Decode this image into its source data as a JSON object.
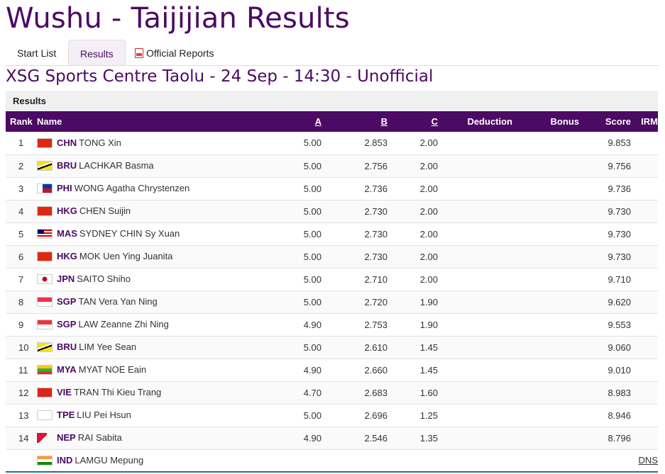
{
  "page": {
    "title": "Wushu - Taijijian Results"
  },
  "tabs": [
    {
      "label": "Start List"
    },
    {
      "label": "Results"
    },
    {
      "label": "Official Reports"
    }
  ],
  "venue_line": "XSG Sports Centre Taolu - 24 Sep - 14:30 - Unofficial",
  "results": {
    "panel_title": "Results",
    "headers": {
      "rank": "Rank",
      "name": "Name",
      "a": "A",
      "b": "B",
      "c": "C",
      "deduction": "Deduction",
      "bonus": "Bonus",
      "score": "Score",
      "irm": "IRM"
    },
    "rows": [
      {
        "rank": "1",
        "noc": "CHN",
        "name": "TONG Xin",
        "a": "5.00",
        "b": "2.853",
        "c": "2.00",
        "deduction": "",
        "bonus": "",
        "score": "9.853",
        "irm": ""
      },
      {
        "rank": "2",
        "noc": "BRU",
        "name": "LACHKAR Basma",
        "a": "5.00",
        "b": "2.756",
        "c": "2.00",
        "deduction": "",
        "bonus": "",
        "score": "9.756",
        "irm": ""
      },
      {
        "rank": "3",
        "noc": "PHI",
        "name": "WONG Agatha Chrystenzen",
        "a": "5.00",
        "b": "2.736",
        "c": "2.00",
        "deduction": "",
        "bonus": "",
        "score": "9.736",
        "irm": ""
      },
      {
        "rank": "4",
        "noc": "HKG",
        "name": "CHEN Suijin",
        "a": "5.00",
        "b": "2.730",
        "c": "2.00",
        "deduction": "",
        "bonus": "",
        "score": "9.730",
        "irm": ""
      },
      {
        "rank": "5",
        "noc": "MAS",
        "name": "SYDNEY CHIN Sy Xuan",
        "a": "5.00",
        "b": "2.730",
        "c": "2.00",
        "deduction": "",
        "bonus": "",
        "score": "9.730",
        "irm": ""
      },
      {
        "rank": "6",
        "noc": "HKG",
        "name": "MOK Uen Ying Juanita",
        "a": "5.00",
        "b": "2.730",
        "c": "2.00",
        "deduction": "",
        "bonus": "",
        "score": "9.730",
        "irm": ""
      },
      {
        "rank": "7",
        "noc": "JPN",
        "name": "SAITO Shiho",
        "a": "5.00",
        "b": "2.710",
        "c": "2.00",
        "deduction": "",
        "bonus": "",
        "score": "9.710",
        "irm": ""
      },
      {
        "rank": "8",
        "noc": "SGP",
        "name": "TAN Vera Yan Ning",
        "a": "5.00",
        "b": "2.720",
        "c": "1.90",
        "deduction": "",
        "bonus": "",
        "score": "9.620",
        "irm": ""
      },
      {
        "rank": "9",
        "noc": "SGP",
        "name": "LAW Zeanne Zhi Ning",
        "a": "4.90",
        "b": "2.753",
        "c": "1.90",
        "deduction": "",
        "bonus": "",
        "score": "9.553",
        "irm": ""
      },
      {
        "rank": "10",
        "noc": "BRU",
        "name": "LIM Yee Sean",
        "a": "5.00",
        "b": "2.610",
        "c": "1.45",
        "deduction": "",
        "bonus": "",
        "score": "9.060",
        "irm": ""
      },
      {
        "rank": "11",
        "noc": "MYA",
        "name": "MYAT NOE Eain",
        "a": "4.90",
        "b": "2.660",
        "c": "1.45",
        "deduction": "",
        "bonus": "",
        "score": "9.010",
        "irm": ""
      },
      {
        "rank": "12",
        "noc": "VIE",
        "name": "TRAN Thi Kieu Trang",
        "a": "4.70",
        "b": "2.683",
        "c": "1.60",
        "deduction": "",
        "bonus": "",
        "score": "8.983",
        "irm": ""
      },
      {
        "rank": "13",
        "noc": "TPE",
        "name": "LIU Pei Hsun",
        "a": "5.00",
        "b": "2.696",
        "c": "1.25",
        "deduction": "",
        "bonus": "",
        "score": "8.946",
        "irm": ""
      },
      {
        "rank": "14",
        "noc": "NEP",
        "name": "RAI Sabita",
        "a": "4.90",
        "b": "2.546",
        "c": "1.35",
        "deduction": "",
        "bonus": "",
        "score": "8.796",
        "irm": ""
      },
      {
        "rank": "",
        "noc": "IND",
        "name": "LAMGU Mepung",
        "a": "",
        "b": "",
        "c": "",
        "deduction": "",
        "bonus": "",
        "score": "",
        "irm": "DNS"
      }
    ]
  },
  "flag_colors": {
    "CHN": "#de2910",
    "BRU": "#f7e017",
    "PHI": "#0038a8",
    "HKG": "#de2910",
    "MAS": "#cc0001",
    "JPN": "#bc002d",
    "SGP": "#ef3340",
    "MYA": "#34b233",
    "VIE": "#da251d",
    "TPE": "#fe0000",
    "NEP": "#dc143c",
    "IND": "#ff9933"
  },
  "theme": {
    "brand_purple": "#4b0a63",
    "header_row_bg": "#4b0a63",
    "active_tab_bg": "#f4eef6",
    "bottom_rule": "#1e6fa8"
  }
}
